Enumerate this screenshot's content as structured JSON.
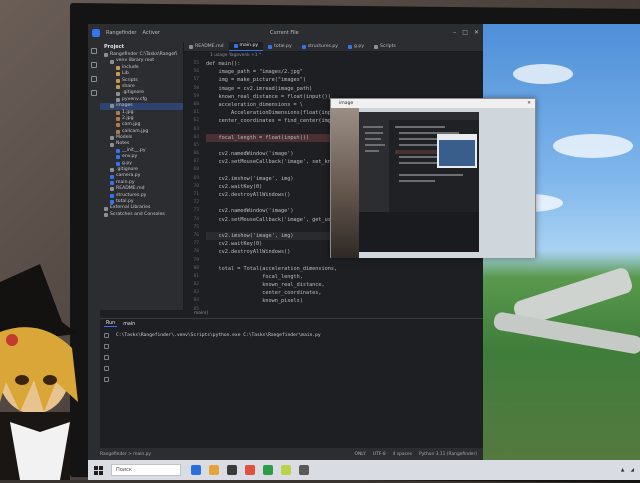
{
  "ide": {
    "title_left": "Rangefinder",
    "title_branch": "Activer",
    "title_right": "Current File",
    "project_header": "Project",
    "tree": [
      {
        "label": "Rangefinder  C:\\Tasks\\Rangefi",
        "indent": 0,
        "color": "#8c8f94"
      },
      {
        "label": "venv  library root",
        "indent": 1,
        "color": "#8c8f94"
      },
      {
        "label": "include",
        "indent": 2,
        "color": "#c49a50"
      },
      {
        "label": "Lib",
        "indent": 2,
        "color": "#c49a50"
      },
      {
        "label": "Scripts",
        "indent": 2,
        "color": "#c49a50"
      },
      {
        "label": "share",
        "indent": 2,
        "color": "#c49a50"
      },
      {
        "label": ".gitignore",
        "indent": 2,
        "color": "#8c8f94"
      },
      {
        "label": "pyvenv.cfg",
        "indent": 2,
        "color": "#8c8f94"
      },
      {
        "label": "images",
        "indent": 1,
        "color": "#8c8f94",
        "selected": true
      },
      {
        "label": "1.jpg",
        "indent": 2,
        "color": "#b07b4b"
      },
      {
        "label": "2.jpg",
        "indent": 2,
        "color": "#b07b4b"
      },
      {
        "label": "cam.jpg",
        "indent": 2,
        "color": "#b07b4b"
      },
      {
        "label": "calicam.jpg",
        "indent": 2,
        "color": "#b07b4b"
      },
      {
        "label": "Models",
        "indent": 1,
        "color": "#8c8f94"
      },
      {
        "label": "Notes",
        "indent": 1,
        "color": "#8c8f94"
      },
      {
        "label": "__init__.py",
        "indent": 2,
        "color": "#3574f0"
      },
      {
        "label": "env.py",
        "indent": 2,
        "color": "#3574f0"
      },
      {
        "label": "g.py",
        "indent": 2,
        "color": "#3574f0"
      },
      {
        "label": ".gitignore",
        "indent": 1,
        "color": "#8c8f94"
      },
      {
        "label": "camera.py",
        "indent": 1,
        "color": "#3574f0"
      },
      {
        "label": "main.py",
        "indent": 1,
        "color": "#3574f0"
      },
      {
        "label": "README.md",
        "indent": 1,
        "color": "#8c8f94"
      },
      {
        "label": "structures.py",
        "indent": 1,
        "color": "#3574f0"
      },
      {
        "label": "total.py",
        "indent": 1,
        "color": "#3574f0"
      },
      {
        "label": "External Libraries",
        "indent": 0,
        "color": "#8c8f94"
      },
      {
        "label": "Scratches and Consoles",
        "indent": 0,
        "color": "#8c8f94"
      }
    ],
    "tabs": [
      {
        "label": "README.md",
        "active": false
      },
      {
        "label": "main.py",
        "active": true
      },
      {
        "label": "total.py",
        "active": false
      },
      {
        "label": "structures.py",
        "active": false
      },
      {
        "label": "g.py",
        "active": false
      },
      {
        "label": "Scripts",
        "active": false
      }
    ],
    "usages": "1 usage    Yagovenk +1 *",
    "line_numbers": [
      "55",
      "56",
      "57",
      "58",
      "59",
      "60",
      "61",
      "62",
      "63",
      "64",
      "65",
      "66",
      "67",
      "68",
      "69",
      "70",
      "71",
      "72",
      "73",
      "74",
      "75",
      "76",
      "77",
      "78",
      "79",
      "80",
      "81",
      "82",
      "83",
      "84",
      "85"
    ],
    "code": [
      {
        "text": "def main():",
        "style": ""
      },
      {
        "text": "    image_path = \"images/2.jpg\"",
        "style": ""
      },
      {
        "text": "    img = make_picture(\"images\")",
        "style": ""
      },
      {
        "text": "    image = cv2.imread(image_path)",
        "style": ""
      },
      {
        "text": "    known_real_distance = float(input())",
        "style": ""
      },
      {
        "text": "    acceleration_dimensions = \\",
        "style": ""
      },
      {
        "text": "        AccelerationDimensions(float(input()),",
        "style": ""
      },
      {
        "text": "    center_coordinates = find_center(img)",
        "style": ""
      },
      {
        "text": "",
        "style": ""
      },
      {
        "text": "    focal_length = float(input())",
        "style": "hl"
      },
      {
        "text": "",
        "style": ""
      },
      {
        "text": "    cv2.namedWindow('image')",
        "style": ""
      },
      {
        "text": "    cv2.setMouseCallback('image', set_known_pi",
        "style": ""
      },
      {
        "text": "",
        "style": ""
      },
      {
        "text": "    cv2.imshow('image', img)",
        "style": ""
      },
      {
        "text": "    cv2.waitKey(0)",
        "style": ""
      },
      {
        "text": "    cv2.destroyAllWindows()",
        "style": ""
      },
      {
        "text": "",
        "style": ""
      },
      {
        "text": "    cv2.namedWindow('image')",
        "style": ""
      },
      {
        "text": "    cv2.setMouseCallback('image', get_user_pi",
        "style": ""
      },
      {
        "text": "",
        "style": ""
      },
      {
        "text": "    cv2.imshow('image', img)",
        "style": "cur"
      },
      {
        "text": "    cv2.waitKey(0)",
        "style": ""
      },
      {
        "text": "    cv2.destroyAllWindows()",
        "style": ""
      },
      {
        "text": "",
        "style": ""
      },
      {
        "text": "    total = Total(acceleration_dimensions,",
        "style": ""
      },
      {
        "text": "                  focal_length,",
        "style": ""
      },
      {
        "text": "                  known_real_distance,",
        "style": ""
      },
      {
        "text": "                  center_coordinates,",
        "style": ""
      },
      {
        "text": "                  known_pixels)",
        "style": ""
      }
    ],
    "breadcrumb": "main()",
    "run": {
      "tab_run": "Run",
      "tab_main": "main",
      "command": "C:\\Tasks\\Rangefinder\\.venv\\Scripts\\python.exe C:\\Tasks\\Rangefinder\\main.py"
    },
    "status": {
      "left": "Rangefinder  >  main.py",
      "items": [
        "ONLY",
        "UTF-8",
        "4 spaces",
        "Python 3.11 (Rangefinder)"
      ]
    }
  },
  "cv_window": {
    "title": "image",
    "close": "✕"
  },
  "taskbar": {
    "search_placeholder": "Поиск",
    "icons": [
      "#2a6fdb",
      "#e8a23a",
      "#3a3a3a",
      "#e0503a",
      "#2f9d48",
      "#b9d24a",
      "#5a5a5a"
    ]
  }
}
